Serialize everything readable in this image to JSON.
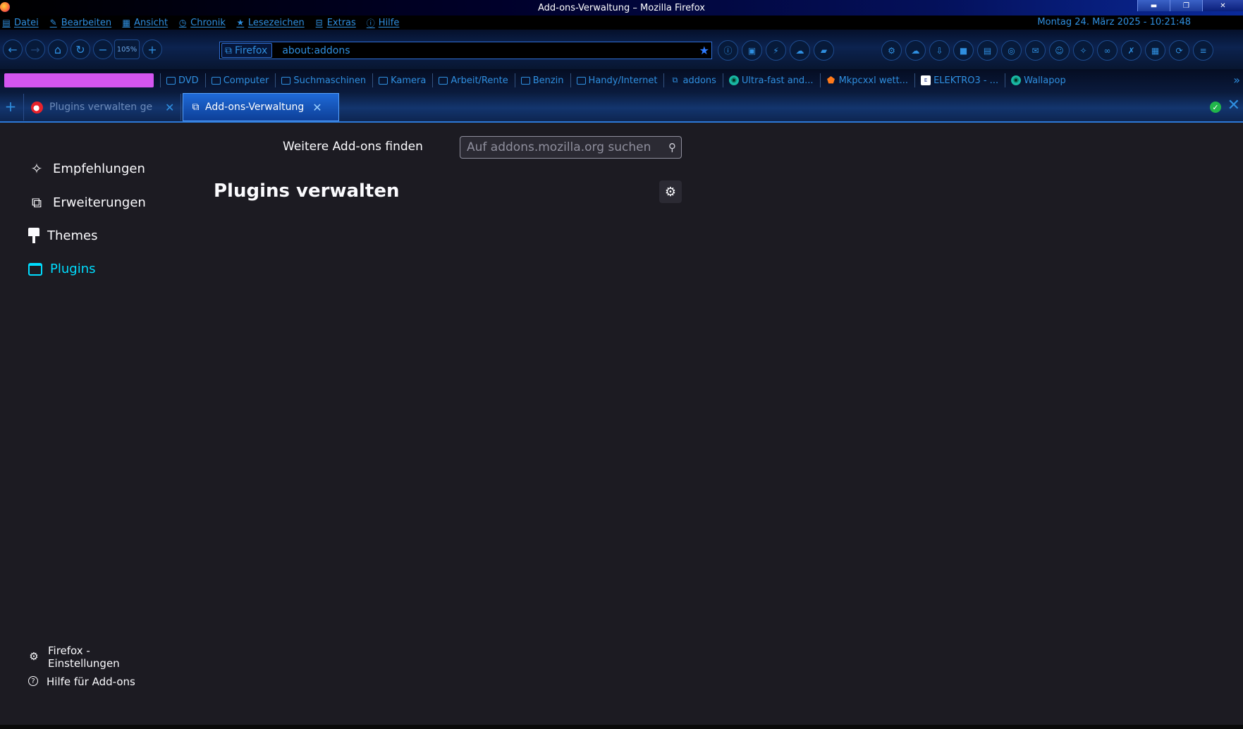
{
  "window": {
    "title": "Add-ons-Verwaltung – Mozilla Firefox"
  },
  "menubar": {
    "items": [
      {
        "label": "Datei",
        "icon": "file-icon"
      },
      {
        "label": "Bearbeiten",
        "icon": "pencil-icon"
      },
      {
        "label": "Ansicht",
        "icon": "view-icon"
      },
      {
        "label": "Chronik",
        "icon": "clock-icon"
      },
      {
        "label": "Lesezeichen",
        "icon": "star-icon"
      },
      {
        "label": "Extras",
        "icon": "toolbox-icon"
      },
      {
        "label": "Hilfe",
        "icon": "help-icon"
      }
    ],
    "datetime": "Montag 24. März 2025 - 10:21:48"
  },
  "navbar": {
    "zoom": "105%",
    "identity_label": "Firefox",
    "url": "about:addons"
  },
  "bookmarks": [
    {
      "label": "DVD",
      "icon": "folder"
    },
    {
      "label": "Computer",
      "icon": "folder"
    },
    {
      "label": "Suchmaschinen",
      "icon": "folder"
    },
    {
      "label": "Kamera",
      "icon": "folder"
    },
    {
      "label": "Arbeit/Rente",
      "icon": "folder"
    },
    {
      "label": "Benzin",
      "icon": "folder"
    },
    {
      "label": "Handy/Internet",
      "icon": "folder"
    },
    {
      "label": "addons",
      "icon": "puzzle"
    },
    {
      "label": "Ultra-fast and...",
      "icon": "teal"
    },
    {
      "label": "Mkpcxxl wett...",
      "icon": "orange"
    },
    {
      "label": "ELEKTRO3 - ...",
      "icon": "white"
    },
    {
      "label": "Wallapop",
      "icon": "teal"
    }
  ],
  "tabs": [
    {
      "title": "Plugins verwalten ge",
      "active": false
    },
    {
      "title": "Add-ons-Verwaltung",
      "active": true
    }
  ],
  "content": {
    "find_label": "Weitere Add-ons finden",
    "search_placeholder": "Auf addons.mozilla.org suchen",
    "title": "Plugins verwalten",
    "categories": [
      {
        "label": "Empfehlungen",
        "selected": false
      },
      {
        "label": "Erweiterungen",
        "selected": false
      },
      {
        "label": "Themes",
        "selected": false
      },
      {
        "label": "Plugins",
        "selected": true
      }
    ],
    "footer": {
      "settings_line1": "Firefox -",
      "settings_line2": "Einstellungen",
      "help": "Hilfe für Add-ons"
    }
  },
  "colors": {
    "accent": "#00ddff",
    "toolbar_blue": "#2f8fe0",
    "background": "#1c1b22"
  }
}
